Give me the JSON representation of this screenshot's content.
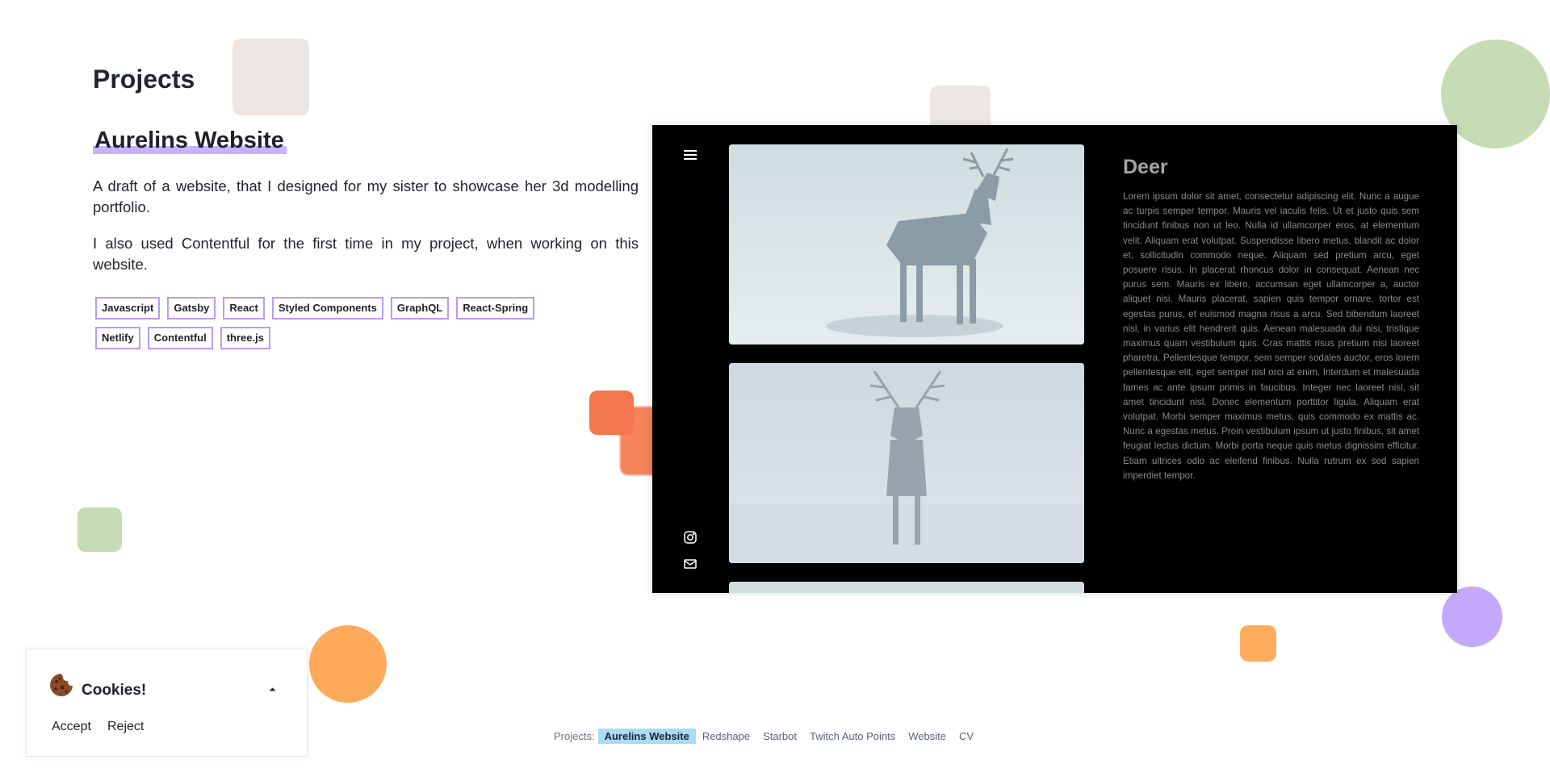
{
  "page": {
    "title": "Projects"
  },
  "project": {
    "title": "Aurelins Website",
    "description_1": "A draft of a website, that I designed for my sister to showcase her 3d modelling portfolio.",
    "description_2": "I also used Contentful for the first time in my project, when working on this website.",
    "tags": [
      "Javascript",
      "Gatsby",
      "React",
      "Styled Components",
      "GraphQL",
      "React-Spring",
      "Netlify",
      "Contentful",
      "three.js"
    ]
  },
  "preview": {
    "menu_icon": "hamburger-menu-icon",
    "title": "Deer",
    "body": "Lorem ipsum dolor sit amet, consectetur adipiscing elit. Nunc a augue ac turpis semper tempor. Mauris vel iaculis felis. Ut et justo quis sem tincidunt finibus non ut leo. Nulla id ullamcorper eros, at elementum velit. Aliquam erat volutpat. Suspendisse libero metus, blandit ac dolor et, sollicitudin commodo neque. Aliquam sed pretium arcu, eget posuere risus. In placerat rhoncus dolor in consequat. Aenean nec purus sem. Mauris ex libero, accumsan eget ullamcorper a, auctor aliquet nisi. Mauris placerat, sapien quis tempor ornare, tortor est egestas purus, et euismod magna risus a arcu. Sed bibendum laoreet nisl, in varius elit hendrerit quis. Aenean malesuada dui nisi, tristique maximus quam vestibulum quis. Cras mattis risus pretium nisi laoreet pharetra. Pellentesque tempor, sem semper sodales auctor, eros lorem pellentesque elit, eget semper nisl orci at enim. Interdum et malesuada fames ac ante ipsum primis in faucibus. Integer nec laoreet nisl, sit amet tincidunt nisl. Donec elementum porttitor ligula. Aliquam erat volutpat. Morbi semper maximus metus, quis commodo ex mattis ac. Nunc a egestas metus. Proin vestibulum ipsum ut justo finibus, sit amet feugiat lectus dictum. Morbi porta neque quis metus dignissim efficitur. Etiam ultrices odio ac eleifend finibus. Nulla rutrum ex sed sapien imperdiet tempor.",
    "icons": [
      "instagram-icon",
      "mail-icon"
    ]
  },
  "cookie": {
    "title": "Cookies!",
    "accept": "Accept",
    "reject": "Reject",
    "toggle_glyph": "⏶"
  },
  "footer": {
    "label": "Projects:",
    "links": [
      "Aurelins Website",
      "Redshape",
      "Starbot",
      "Twitch Auto Points",
      "Website",
      "CV"
    ],
    "active": "Aurelins Website"
  },
  "colors": {
    "accent_purple": "#b79cf6",
    "highlight_purple": "#c8b3fb",
    "footer_active": "#a9dcf5",
    "deco_beige": "#ece7e2",
    "deco_green": "#c5dcb5",
    "deco_orange": "#f57a50",
    "deco_light_orange": "#ffad5c",
    "deco_lavender": "#c4a8fb"
  }
}
